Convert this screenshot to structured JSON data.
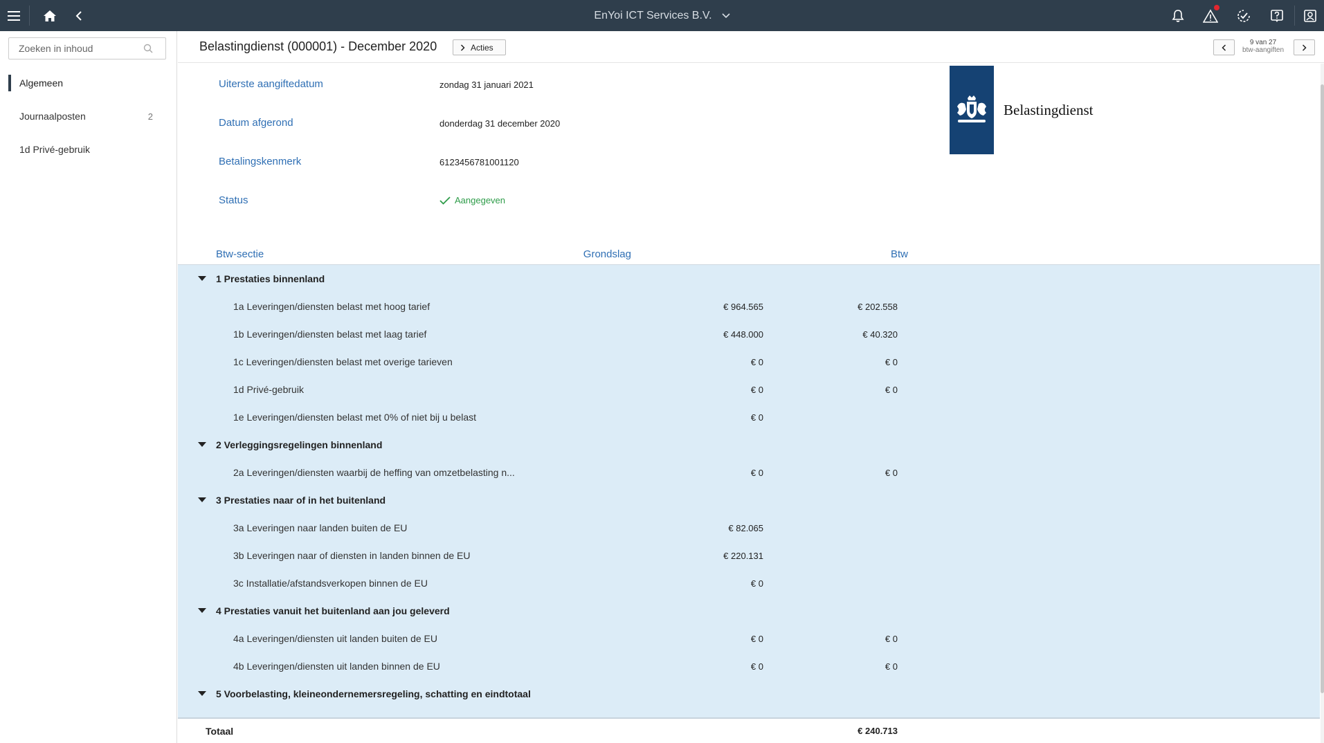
{
  "topbar": {
    "company": "EnYoi ICT Services B.V.",
    "icons": [
      "menu-icon",
      "home-icon",
      "back-icon",
      "bell-icon",
      "warning-icon",
      "check-circle-icon",
      "help-icon",
      "user-icon"
    ]
  },
  "sidebar": {
    "search_placeholder": "Zoeken in inhoud",
    "items": [
      {
        "label": "Algemeen",
        "count": "",
        "active": true
      },
      {
        "label": "Journaalposten",
        "count": "2",
        "active": false
      },
      {
        "label": "1d Privé-gebruik",
        "count": "",
        "active": false
      }
    ]
  },
  "header": {
    "title": "Belastingdienst (000001) - December 2020",
    "acties_label": "Acties",
    "pager_position": "9 van 27",
    "pager_type": "btw-aangiften"
  },
  "details": {
    "fields": [
      {
        "label": "Uiterste aangiftedatum",
        "value": "zondag 31 januari 2021"
      },
      {
        "label": "Datum afgerond",
        "value": "donderdag 31 december 2020"
      },
      {
        "label": "Betalingskenmerk",
        "value": "6123456781001120"
      },
      {
        "label": "Status",
        "value": "Aangegeven"
      }
    ],
    "logo_text": "Belastingdienst",
    "colors": {
      "link": "#2f6fb4",
      "status": "#2e9c49",
      "logo": "#154273",
      "table_bg": "#dcecf7"
    }
  },
  "table": {
    "headers": {
      "section": "Btw-sectie",
      "grondslag": "Grondslag",
      "btw": "Btw"
    },
    "sections": [
      {
        "title": "1 Prestaties binnenland",
        "rows": [
          {
            "label": "1a Leveringen/diensten belast met hoog tarief",
            "grondslag": "€ 964.565",
            "btw": "€ 202.558"
          },
          {
            "label": "1b Leveringen/diensten belast met laag tarief",
            "grondslag": "€ 448.000",
            "btw": "€ 40.320"
          },
          {
            "label": "1c Leveringen/diensten belast met overige tarieven",
            "grondslag": "€ 0",
            "btw": "€ 0"
          },
          {
            "label": "1d Privé-gebruik",
            "grondslag": "€ 0",
            "btw": "€ 0"
          },
          {
            "label": "1e Leveringen/diensten belast met 0% of niet bij u belast",
            "grondslag": "€ 0",
            "btw": ""
          }
        ]
      },
      {
        "title": "2 Verleggingsregelingen binnenland",
        "rows": [
          {
            "label": "2a Leveringen/diensten waarbij de heffing van omzetbelasting n...",
            "grondslag": "€ 0",
            "btw": "€ 0"
          }
        ]
      },
      {
        "title": "3 Prestaties naar of in het buitenland",
        "rows": [
          {
            "label": "3a Leveringen naar landen buiten de EU",
            "grondslag": "€ 82.065",
            "btw": ""
          },
          {
            "label": "3b Leveringen naar of diensten in landen binnen de EU",
            "grondslag": "€ 220.131",
            "btw": ""
          },
          {
            "label": "3c Installatie/afstandsverkopen binnen de EU",
            "grondslag": "€ 0",
            "btw": ""
          }
        ]
      },
      {
        "title": "4 Prestaties vanuit het buitenland aan jou geleverd",
        "rows": [
          {
            "label": "4a Leveringen/diensten uit landen buiten de EU",
            "grondslag": "€ 0",
            "btw": "€ 0"
          },
          {
            "label": "4b Leveringen/diensten uit landen binnen de EU",
            "grondslag": "€ 0",
            "btw": "€ 0"
          }
        ]
      },
      {
        "title": "5 Voorbelasting, kleineondernemersregeling, schatting en eindtotaal",
        "rows": []
      }
    ],
    "total": {
      "label": "Totaal",
      "btw": "€ 240.713"
    }
  }
}
